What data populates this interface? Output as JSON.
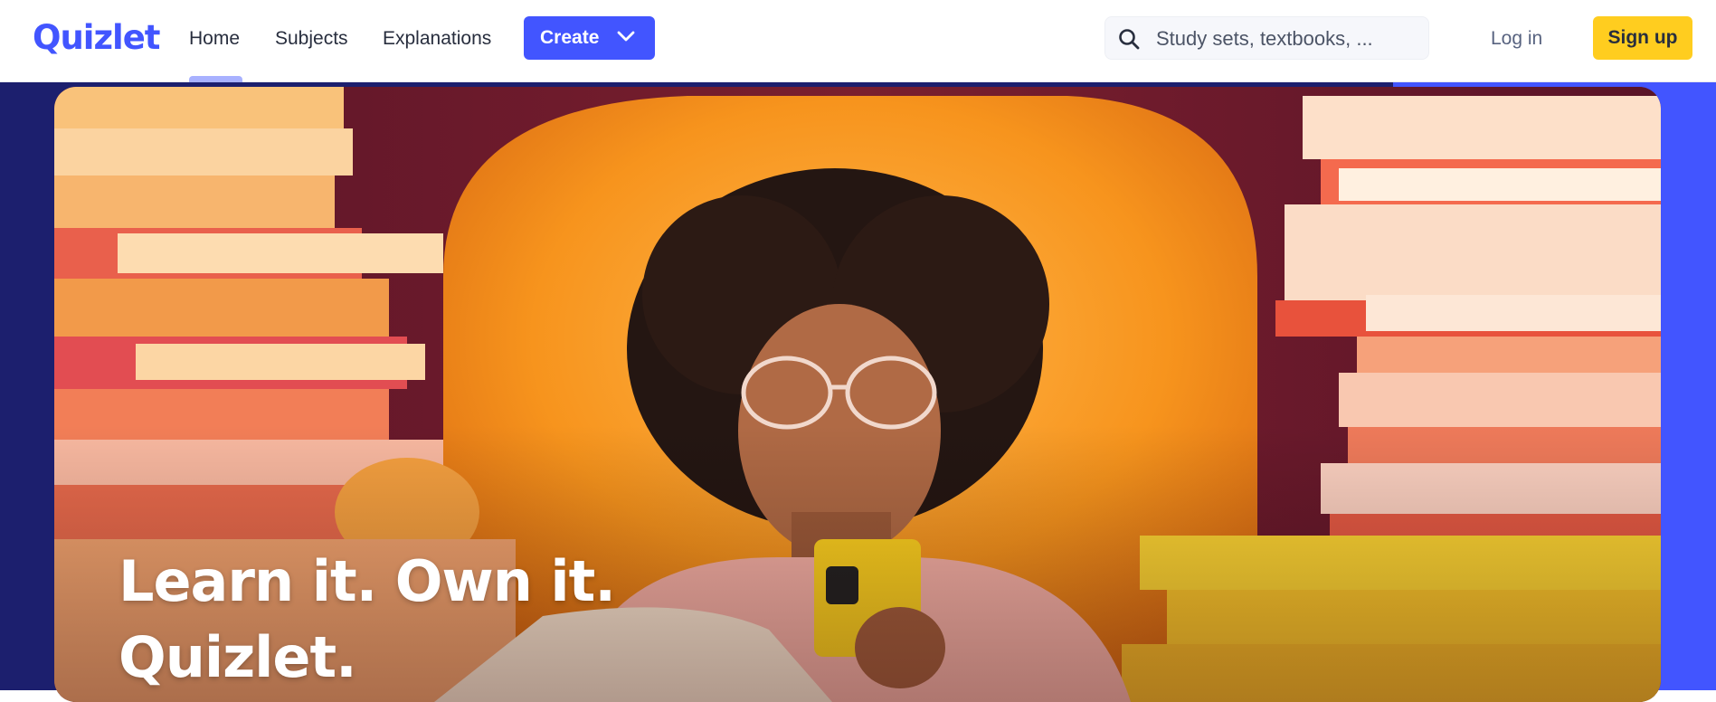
{
  "header": {
    "logo_text": "Quizlet",
    "nav": [
      {
        "label": "Home",
        "active": true
      },
      {
        "label": "Subjects",
        "active": false
      },
      {
        "label": "Explanations",
        "active": false
      }
    ],
    "create_label": "Create",
    "search_placeholder": "Study sets, textbooks, ...",
    "login_label": "Log in",
    "signup_label": "Sign up"
  },
  "hero": {
    "headline_line1": "Learn it. Own it.",
    "headline_line2": "Quizlet.",
    "image": "student-with-phone-between-book-stacks"
  },
  "colors": {
    "brand_blue": "#4255ff",
    "signup_yellow": "#ffcd1f",
    "hero_navy": "#1c1f6e",
    "hero_orange": "#f7941d"
  },
  "icons": {
    "search": "search-icon",
    "create_dropdown": "chevron-down-icon"
  }
}
